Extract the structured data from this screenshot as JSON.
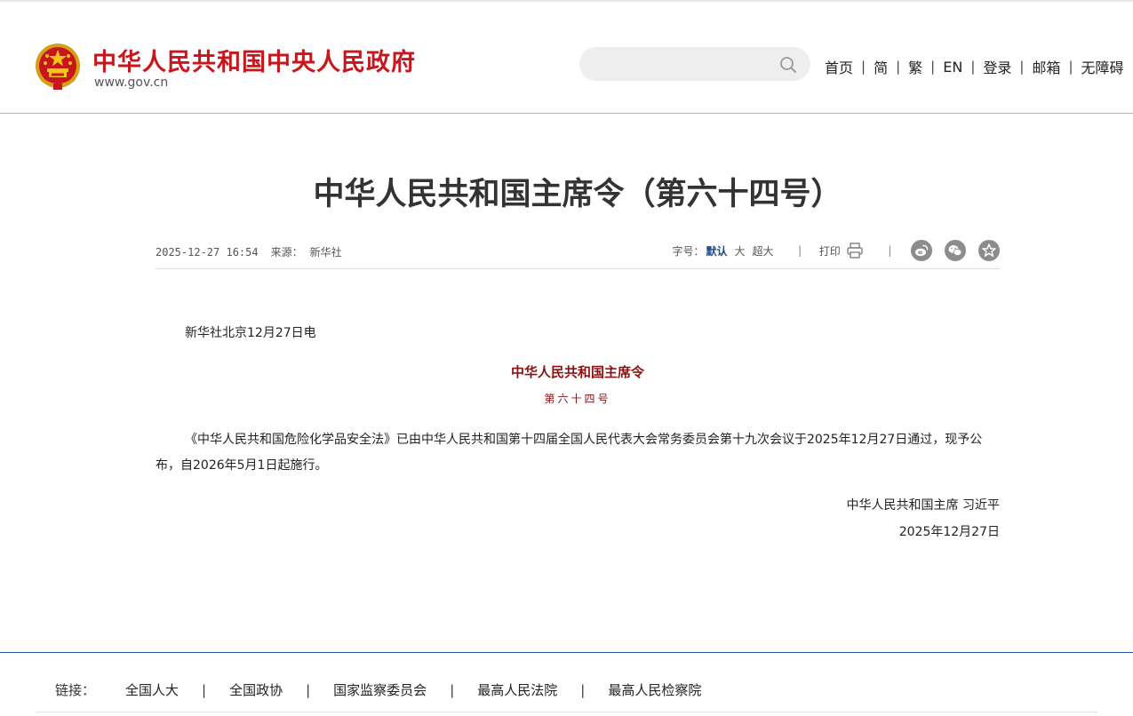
{
  "header": {
    "site_name": "中华人民共和国中央人民政府",
    "site_domain": "www.gov.cn",
    "search": {
      "placeholder": "",
      "value": ""
    },
    "nav": [
      {
        "label": "首页"
      },
      {
        "label": "简"
      },
      {
        "label": "繁"
      },
      {
        "label": "EN"
      },
      {
        "label": "登录"
      },
      {
        "label": "邮箱"
      },
      {
        "label": "无障碍"
      }
    ],
    "separator": "|"
  },
  "article": {
    "title": "中华人民共和国主席令（第六十四号）",
    "meta": {
      "datetime": "2025-12-27 16:54",
      "source_label": "来源：",
      "source": "新华社",
      "font_size_label": "字号：",
      "font_sizes": [
        "默认",
        "大",
        "超大"
      ],
      "font_size_selected": "默认",
      "separator": "|",
      "print_label": "打印"
    },
    "share_icons": [
      "weibo-icon",
      "wechat-icon",
      "favorite-icon"
    ],
    "dateline": "新华社北京12月27日电",
    "order_title": "中华人民共和国主席令",
    "order_number": "第六十四号",
    "paragraph": "《中华人民共和国危险化学品安全法》已由中华人民共和国第十四届全国人民代表大会常务委员会第十九次会议于2025年12月27日通过，现予公布，自2026年5月1日起施行。",
    "signature": "中华人民共和国主席 习近平",
    "sign_date": "2025年12月27日"
  },
  "footer": {
    "links_label": "链接：",
    "links": [
      "全国人大",
      "全国政协",
      "国家监察委员会",
      "最高人民法院",
      "最高人民检察院"
    ],
    "separator": "|"
  },
  "colors": {
    "brand_red": "#c8161d",
    "order_red": "#8b1111",
    "accent_blue": "#1c4b86",
    "footer_line": "#1f5a96"
  }
}
